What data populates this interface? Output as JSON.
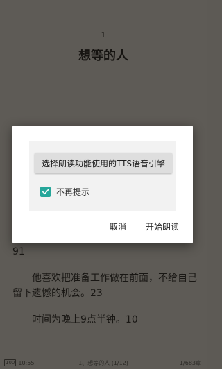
{
  "reader": {
    "chapter_number": "1",
    "chapter_title": "想等的人",
    "paragraphs": [
      "91",
      "他喜欢把准备工作做在前面，不给自己留下遗憾的机会。23",
      "时间为晚上9点半钟。10"
    ]
  },
  "footer": {
    "battery": "100",
    "time": "10:55",
    "chapter_progress": "1、想等的人 (1/12)",
    "page_progress": "1/683章"
  },
  "dialog": {
    "engine_button_label": "选择朗读功能使用的TTS语音引擎",
    "checkbox_label": "不再提示",
    "checkbox_checked": true,
    "cancel_label": "取消",
    "start_label": "开始朗读"
  },
  "colors": {
    "accent": "#26a69a",
    "reader_background": "#5e5b56",
    "dialog_background": "#ffffff"
  }
}
